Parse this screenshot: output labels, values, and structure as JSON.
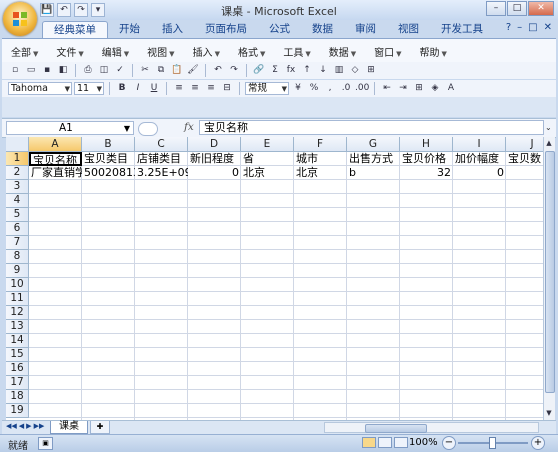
{
  "window": {
    "title": "课桌 - Microsoft Excel",
    "controls": [
      "–",
      "□",
      "✕"
    ]
  },
  "quick_access": [
    "💾",
    "↶",
    "↷",
    "▾"
  ],
  "ribbon_tabs": [
    "经典菜单",
    "开始",
    "插入",
    "页面布局",
    "公式",
    "数据",
    "审阅",
    "视图",
    "开发工具"
  ],
  "active_tab": "经典菜单",
  "ribbon_right": [
    "?",
    "–",
    "□",
    "✕"
  ],
  "menus": [
    "全部",
    "文件",
    "编辑",
    "视图",
    "插入",
    "格式",
    "工具",
    "数据",
    "窗口",
    "帮助"
  ],
  "toolbar": {
    "font_name": "Tahoma",
    "font_size": "11",
    "bold": "B",
    "italic": "I",
    "underline": "U",
    "number_format": "常规",
    "percent": "%",
    "comma": ",",
    "inc_decimal": ".0",
    "dec_decimal": ".00",
    "sum": "Σ",
    "fx": "fx"
  },
  "formula_bar": {
    "name_box": "A1",
    "fx_label": "fx",
    "content": "宝贝名称"
  },
  "grid": {
    "columns": [
      "A",
      "B",
      "C",
      "D",
      "E",
      "F",
      "G",
      "H",
      "I",
      "J"
    ],
    "rows": [
      "1",
      "2",
      "3",
      "4",
      "5",
      "6",
      "7",
      "8",
      "9",
      "10",
      "11",
      "12",
      "13",
      "14",
      "15",
      "16",
      "17",
      "18",
      "19"
    ],
    "row1": [
      "宝贝名称",
      "宝贝类目",
      "店铺类目",
      "新旧程度",
      "省",
      "城市",
      "出售方式",
      "宝贝价格",
      "加价幅度",
      "宝贝数"
    ],
    "row2": [
      "厂家直销学",
      "50020813",
      "3.25E+09",
      "0",
      "北京",
      "北京",
      "b",
      "32",
      "0",
      ""
    ],
    "active_cell": "A1"
  },
  "sheets": [
    "课桌"
  ],
  "status": {
    "mode": "就绪",
    "zoom": "100%"
  },
  "colors": {
    "ribbon_blue": "#15428b",
    "grid_line": "#d0d7e5",
    "selected_header": "#f6c86b"
  }
}
